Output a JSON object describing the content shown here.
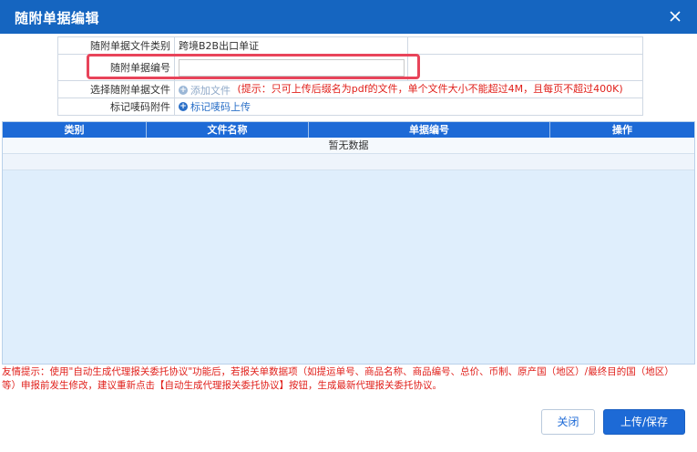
{
  "dialog": {
    "title": "随附单据编辑"
  },
  "form": {
    "rows": [
      {
        "label": "随附单据文件类别",
        "value": "跨境B2B出口单证"
      },
      {
        "label": "随附单据编号",
        "value": ""
      },
      {
        "label": "选择随附单据文件",
        "add_label": "添加文件",
        "hint": "(提示：只可上传后缀名为pdf的文件，单个文件大小不能超过4M，且每页不超过400K)"
      },
      {
        "label": "标记唛码附件",
        "link_label": "标记唛码上传"
      }
    ]
  },
  "table": {
    "columns": [
      "类别",
      "文件名称",
      "单据编号",
      "操作"
    ],
    "empty_text": "暂无数据"
  },
  "tip": {
    "line1": "友情提示：使用\"自动生成代理报关委托协议\"功能后，若报关单数据项（如提运单号、商品名称、商品编号、总价、币制、原产国（地区）/最终目的国（地区）",
    "line2": "等）申报前发生修改，建议重新点击【自动生成代理报关委托协议】按钮，生成最新代理报关委托协议。"
  },
  "buttons": {
    "close_label": "关闭",
    "save_label": "上传/保存"
  },
  "colors": {
    "title_bar": "#1565c0",
    "grid_header": "#1d6ad6",
    "grid_body": "#dfeefc",
    "hint_red": "#e0201b",
    "highlight": "#e8445a"
  }
}
